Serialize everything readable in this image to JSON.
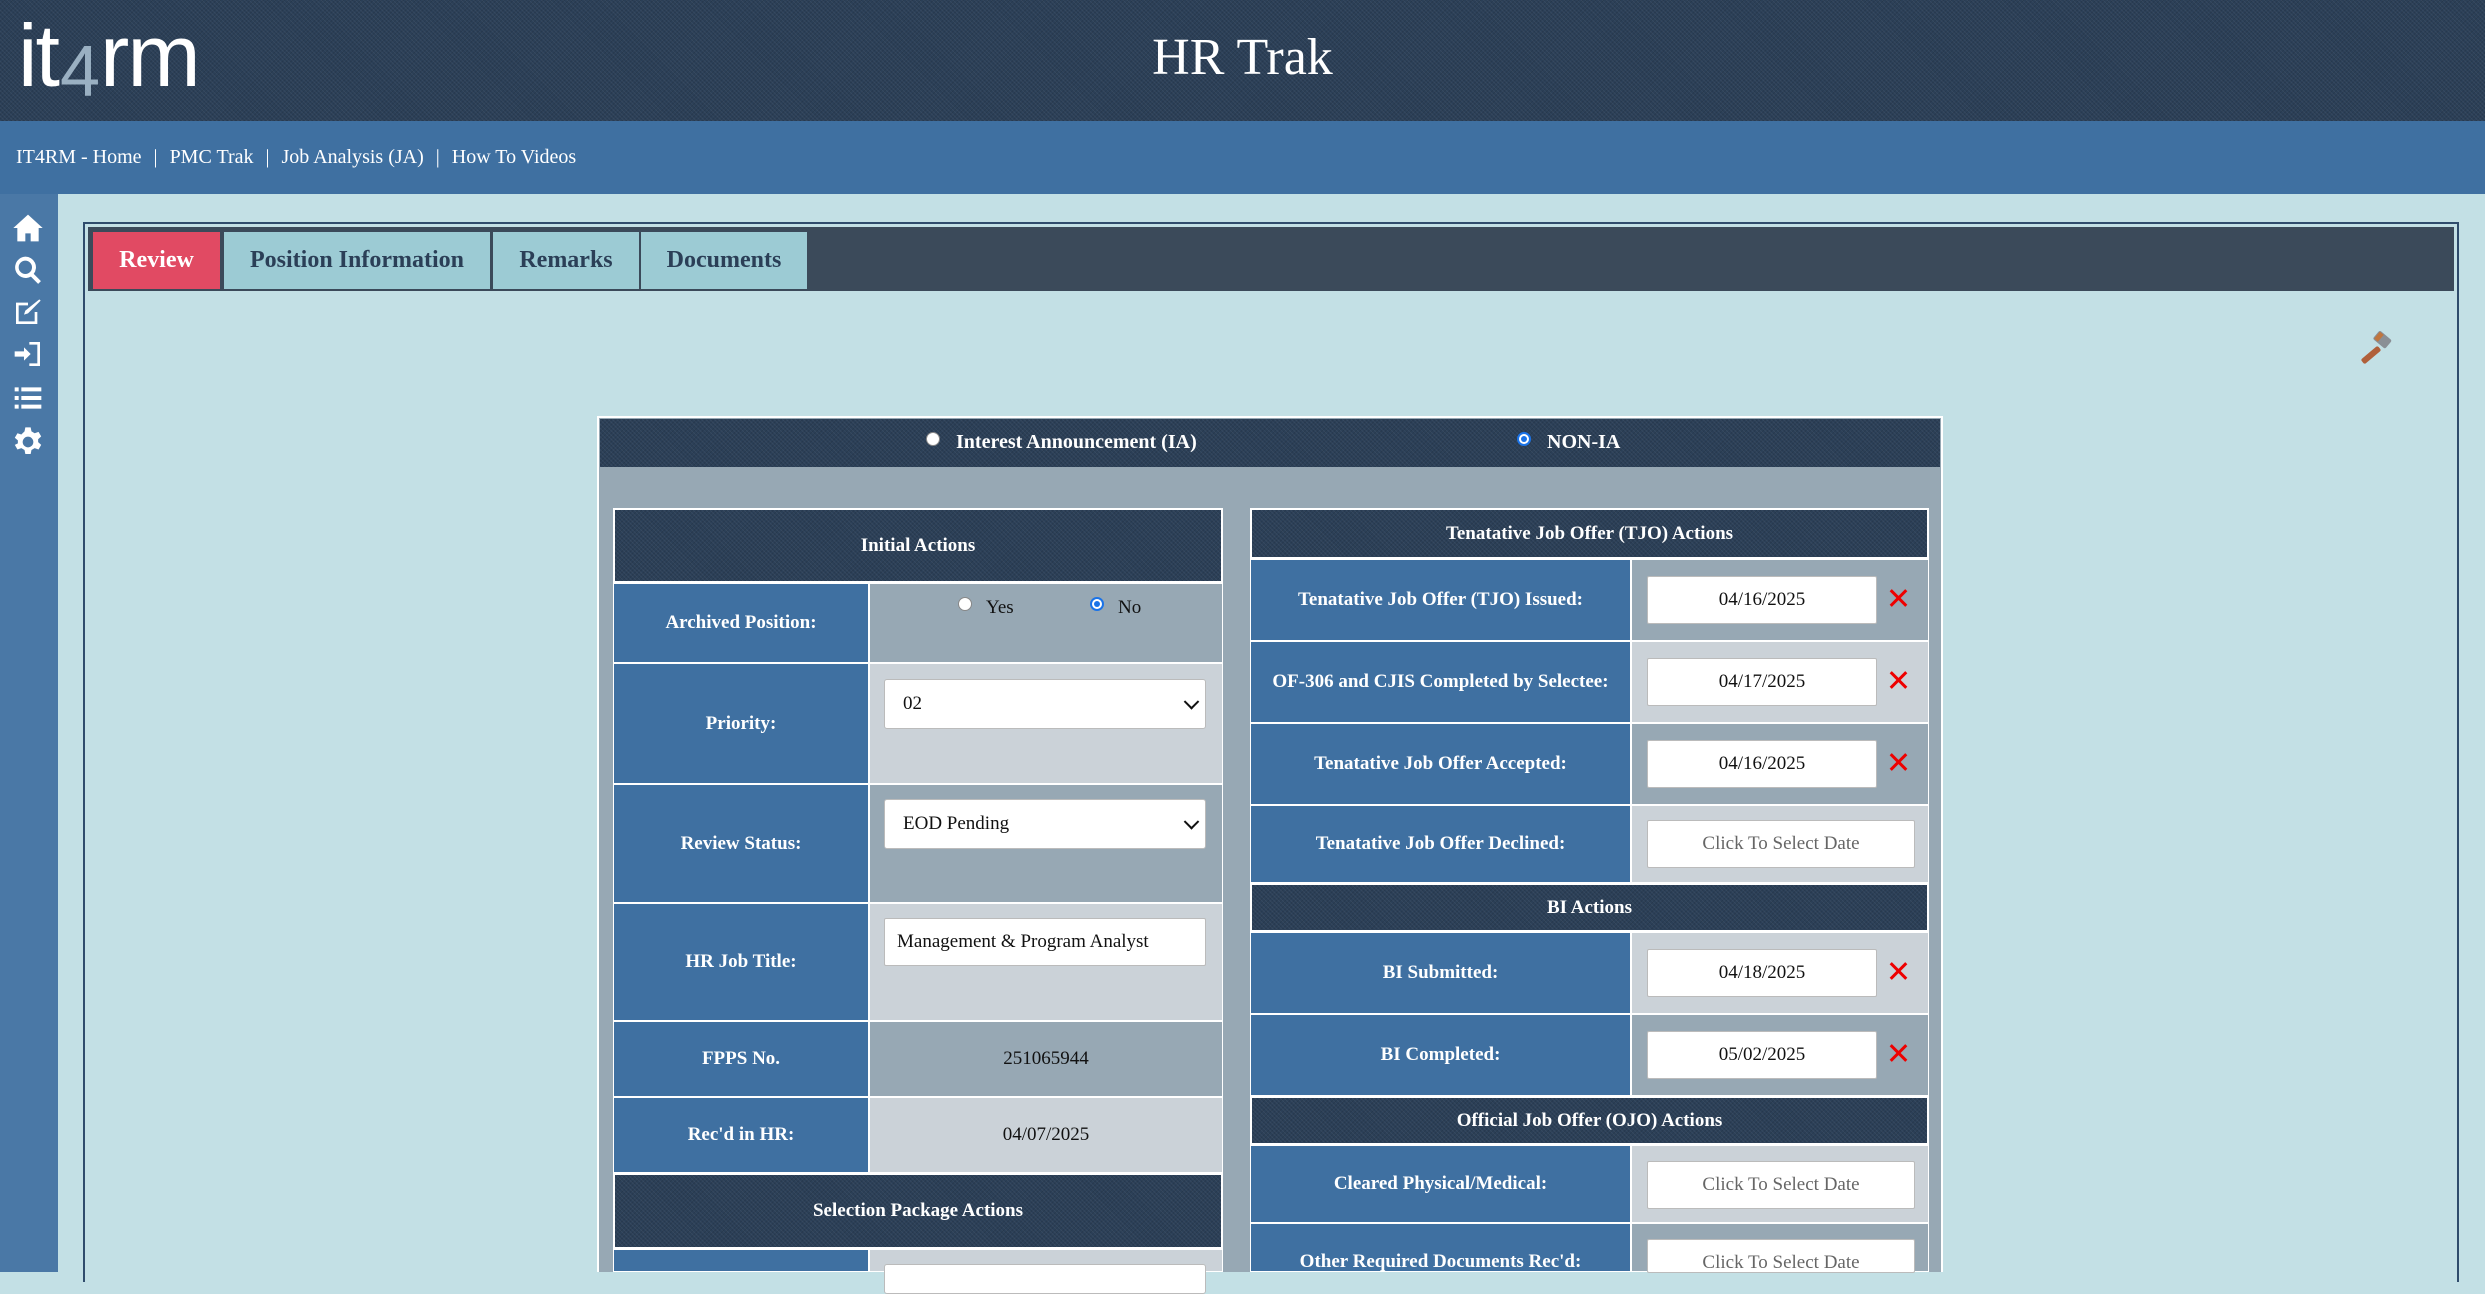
{
  "header": {
    "logo_text_1": "it",
    "logo_text_2": "4",
    "logo_text_3": "rm",
    "title": "HR Trak"
  },
  "nav": {
    "links": [
      "IT4RM - Home",
      "PMC Trak",
      "Job Analysis (JA)",
      "How To Videos"
    ],
    "separator": "|"
  },
  "sidebar": {
    "icons": [
      "home-icon",
      "search-icon",
      "edit-icon",
      "sign-in-icon",
      "list-icon",
      "gear-icon"
    ]
  },
  "tabs": [
    {
      "label": "Review",
      "active": true
    },
    {
      "label": "Position Information",
      "active": false
    },
    {
      "label": "Remarks",
      "active": false
    },
    {
      "label": "Documents",
      "active": false
    }
  ],
  "toolbar": {
    "tool_icon": "hammer-icon"
  },
  "announcement": {
    "options": [
      {
        "label": "Interest Announcement (IA)",
        "checked": false
      },
      {
        "label": "NON-IA",
        "checked": true
      }
    ]
  },
  "initial": {
    "title": "Initial Actions",
    "archived": {
      "label": "Archived Position:",
      "yes": "Yes",
      "no": "No",
      "selected": "No"
    },
    "priority": {
      "label": "Priority:",
      "value": "02"
    },
    "review_status": {
      "label": "Review Status:",
      "value": "EOD Pending"
    },
    "hr_job_title": {
      "label": "HR Job Title:",
      "value": "Management & Program Analyst"
    },
    "fpps_no": {
      "label": "FPPS No.",
      "value": "251065944"
    },
    "recd_in_hr": {
      "label": "Rec'd in HR:",
      "value": "04/07/2025"
    }
  },
  "selection": {
    "title": "Selection Package Actions"
  },
  "tjo": {
    "title": "Tenatative Job Offer (TJO) Actions",
    "rows": [
      {
        "label": "Tenatative Job Offer (TJO) Issued:",
        "value": "04/16/2025",
        "clearable": true
      },
      {
        "label": "OF-306 and CJIS Completed by Selectee:",
        "value": "04/17/2025",
        "clearable": true
      },
      {
        "label": "Tenatative Job Offer Accepted:",
        "value": "04/16/2025",
        "clearable": true
      },
      {
        "label": "Tenatative Job Offer Declined:",
        "value": "",
        "clearable": false
      }
    ]
  },
  "bi": {
    "title": "BI Actions",
    "rows": [
      {
        "label": "BI Submitted:",
        "value": "04/18/2025",
        "clearable": true
      },
      {
        "label": "BI Completed:",
        "value": "05/02/2025",
        "clearable": true
      }
    ]
  },
  "ojo": {
    "title": "Official Job Offer (OJO) Actions",
    "rows": [
      {
        "label": "Cleared Physical/Medical:",
        "value": "",
        "clearable": false
      },
      {
        "label": "Other Required Documents Rec'd:",
        "value": "",
        "clearable": false
      }
    ]
  },
  "date_placeholder": "Click To Select Date",
  "colors": {
    "header_bg": "#2b3f57",
    "nav_bg": "#3f70a1",
    "page_bg": "#c3e0e5",
    "tab_active": "#e14a63",
    "tab_inactive": "#9ccbd4",
    "label_bg": "#3f70a1",
    "clear_red": "#e00000"
  }
}
